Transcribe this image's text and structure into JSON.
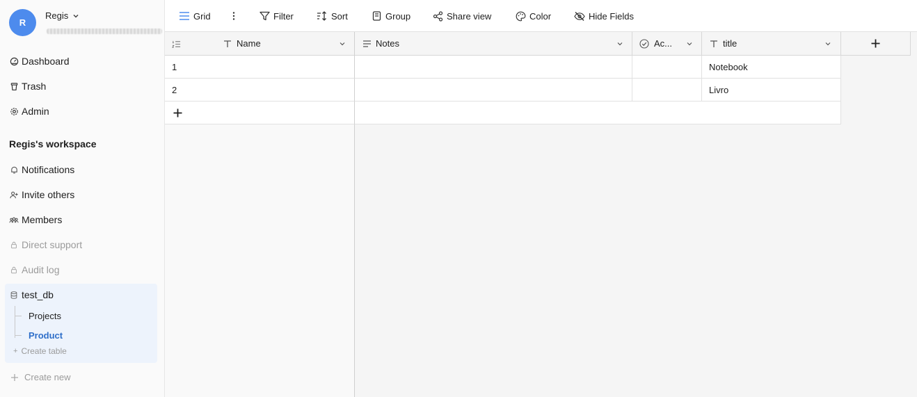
{
  "user": {
    "initial": "R",
    "name": "Regis"
  },
  "nav": {
    "dashboard": "Dashboard",
    "trash": "Trash",
    "admin": "Admin",
    "workspace_title": "Regis's workspace",
    "notifications": "Notifications",
    "invite": "Invite others",
    "members": "Members",
    "direct_support": "Direct support",
    "audit_log": "Audit log"
  },
  "database": {
    "name": "test_db",
    "tables": [
      "Projects",
      "Product"
    ],
    "active_table": "Product",
    "create_table": "Create table"
  },
  "create_new": "Create new",
  "toolbar": {
    "view": "Grid",
    "filter": "Filter",
    "sort": "Sort",
    "group": "Group",
    "share": "Share view",
    "color": "Color",
    "hide_fields": "Hide Fields"
  },
  "grid": {
    "columns": [
      {
        "label": "Name",
        "icon": "text-icon"
      },
      {
        "label": "Notes",
        "icon": "long-text-icon"
      },
      {
        "label": "Ac...",
        "icon": "boolean-check-icon"
      },
      {
        "label": "title",
        "icon": "text-icon"
      }
    ],
    "rows": [
      {
        "id": "1",
        "name": "",
        "notes": "",
        "active": "",
        "title": "Notebook"
      },
      {
        "id": "2",
        "name": "",
        "notes": "",
        "active": "",
        "title": "Livro"
      }
    ]
  },
  "colors": {
    "accent": "#4d8bed",
    "active_link": "#2f6fc9",
    "db_bg": "#edf3fc"
  }
}
